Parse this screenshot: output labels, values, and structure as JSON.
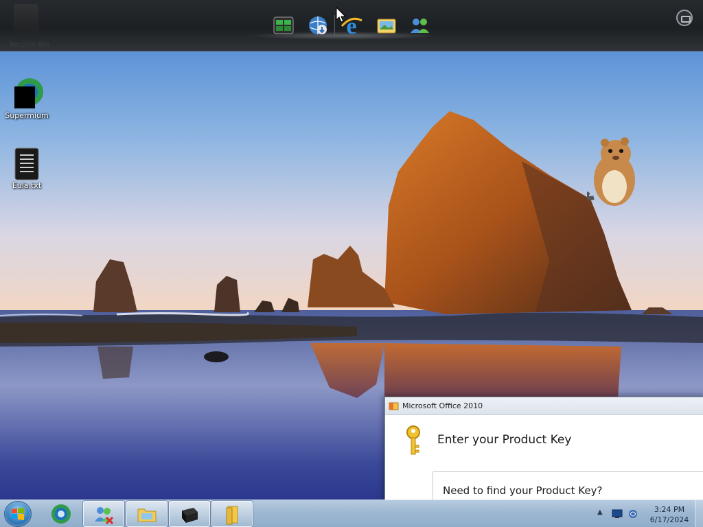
{
  "desktop": {
    "icons": [
      {
        "label": "Supermium",
        "icon": "supermium-browser-icon"
      },
      {
        "label": "Eula.txt",
        "icon": "text-file-icon"
      }
    ]
  },
  "dock": {
    "recycle_bin_label": "Recycle Bin",
    "icons": [
      "task-manager-icon",
      "network-globe-icon",
      "internet-explorer-icon",
      "photo-viewer-icon",
      "users-icon"
    ]
  },
  "dialog": {
    "title": "Microsoft Office 2010",
    "heading": "Enter your Product Key",
    "panel_text": "Need to find your Product Key?"
  },
  "taskbar": {
    "buttons": [
      "messenger-icon",
      "file-explorer-icon",
      "terminal-window-icon",
      "documents-folder-icon"
    ],
    "pinned": [
      "supermium-browser-icon"
    ],
    "tray_icons": [
      "show-hidden-icons-arrow",
      "network-monitor-icon",
      "volume-network-icon"
    ]
  },
  "clock": {
    "time": "3:24 PM",
    "date": "6/17/2024"
  },
  "colors": {
    "accent": "#2e78b8",
    "taskbar": "#9eb8d2",
    "dock": "#1d2023"
  }
}
